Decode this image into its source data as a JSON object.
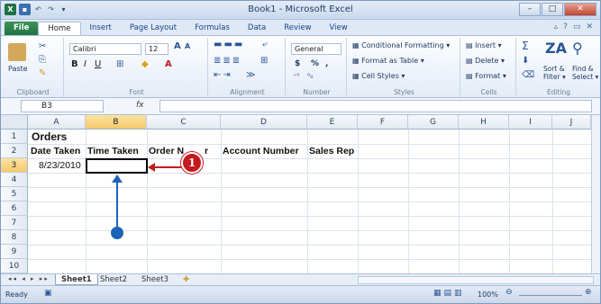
{
  "window": {
    "title": "Book1 - Microsoft Excel"
  },
  "tabs": [
    "File",
    "Home",
    "Insert",
    "Page Layout",
    "Formulas",
    "Data",
    "Review",
    "View"
  ],
  "ribbon": {
    "clipboard": {
      "label": "Clipboard",
      "paste": "Paste"
    },
    "font": {
      "label": "Font",
      "name": "Calibri",
      "size": "12"
    },
    "alignment": {
      "label": "Alignment"
    },
    "number": {
      "label": "Number",
      "format": "General",
      "currency": "$",
      "percent": "%",
      "comma": ","
    },
    "styles": {
      "label": "Styles",
      "conditional": "Conditional Formatting",
      "format_table": "Format as Table",
      "cell_styles": "Cell Styles"
    },
    "cells": {
      "label": "Cells",
      "insert": "Insert",
      "delete": "Delete",
      "format": "Format"
    },
    "editing": {
      "label": "Editing",
      "sort": "Sort &",
      "sort2": "Filter",
      "find": "Find &",
      "find2": "Select"
    }
  },
  "formula_bar": {
    "name_box": "B3",
    "fx": "fx",
    "value": ""
  },
  "grid": {
    "columns": [
      "A",
      "B",
      "C",
      "D",
      "E",
      "F",
      "G",
      "H",
      "I",
      "J"
    ],
    "rows": [
      "1",
      "2",
      "3",
      "4",
      "5",
      "6",
      "7",
      "8",
      "9",
      "10"
    ],
    "cells": {
      "a1": "Orders",
      "a2": "Date Taken",
      "b2": "Time Taken",
      "c2": "Order N",
      "c2b": "r",
      "d2": "Account Number",
      "e2": "Sales Rep",
      "a3": "8/23/2010"
    },
    "selected_cell": "B3"
  },
  "sheets": [
    "Sheet1",
    "Sheet2",
    "Sheet3"
  ],
  "status": {
    "ready": "Ready",
    "zoom": "100%"
  },
  "callout": {
    "number": "1",
    "color": "#c41a1f",
    "pointer_color": "#1c63b7"
  }
}
